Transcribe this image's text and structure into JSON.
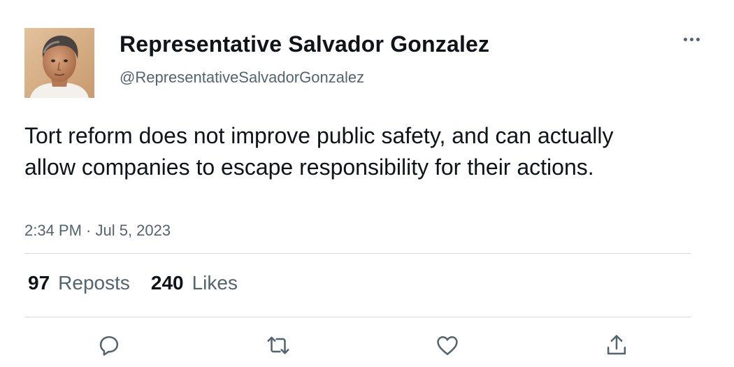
{
  "author": {
    "display_name": "Representative Salvador Gonzalez",
    "handle": "@RepresentativeSalvadorGonzalez"
  },
  "tweet": {
    "text": "Tort reform does not improve public safety, and can actually allow companies to escape responsibility for their actions.",
    "timestamp": "2:34 PM · Jul 5, 2023"
  },
  "stats": {
    "reposts_count": "97",
    "reposts_label": "Reposts",
    "likes_count": "240",
    "likes_label": "Likes"
  },
  "actions": [
    {
      "name": "reply",
      "icon": "reply-icon"
    },
    {
      "name": "repost",
      "icon": "repost-icon"
    },
    {
      "name": "like",
      "icon": "heart-icon"
    },
    {
      "name": "share",
      "icon": "share-icon"
    }
  ],
  "colors": {
    "primary_text": "#0f1419",
    "secondary_text": "#536471",
    "divider": "#d9dde1",
    "background": "#ffffff"
  }
}
